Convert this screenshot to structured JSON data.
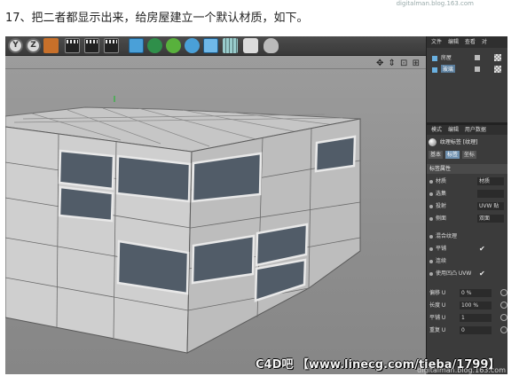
{
  "caption": "17、把二者都显示出来，给房屋建立一个默认材质，如下。",
  "top_watermark": "digitalman.blog.163.com",
  "toolbar": {
    "icons": [
      "y-axis-icon",
      "z-axis-icon",
      "world-coord-icon",
      "render-view-icon",
      "render-active-icon",
      "render-settings-icon",
      "cube-primitive-icon",
      "pen-spline-icon",
      "subdivision-gear-icon",
      "geometry-generator-icon",
      "deformer-grid-icon",
      "camera-icon",
      "light-bulb-icon"
    ],
    "y_label": "Y",
    "z_label": "Z"
  },
  "viewport": {
    "nav_icons": "✥ ⇕ ⊡ ⊞"
  },
  "object_manager": {
    "tabs": [
      "文件",
      "编辑",
      "查看",
      "对"
    ],
    "objects": [
      {
        "name": "房屋",
        "selected": false
      },
      {
        "name": "玻璃",
        "selected": true
      }
    ]
  },
  "attribute_manager": {
    "tabs": [
      "模式",
      "编辑",
      "用户数据"
    ],
    "header": "纹理标签 [纹理]",
    "subtabs": [
      {
        "label": "基本",
        "active": false
      },
      {
        "label": "标签",
        "active": true
      },
      {
        "label": "坐标",
        "active": false
      }
    ],
    "section": "标签属性",
    "props": [
      {
        "label": "材质",
        "value": "材质"
      },
      {
        "label": "选集",
        "value": ""
      },
      {
        "label": "投射",
        "value": "UVW 贴"
      },
      {
        "label": "侧面",
        "value": "双面"
      }
    ],
    "checks": [
      {
        "label": "混合纹理",
        "value": ""
      },
      {
        "label": "平铺",
        "value": "✔"
      },
      {
        "label": "连续",
        "value": ""
      },
      {
        "label": "使用凹凸 UVW",
        "value": "✔"
      }
    ],
    "numbers": [
      {
        "label": "偏移 U",
        "value": "0 %"
      },
      {
        "label": "长度 U",
        "value": "100 %"
      },
      {
        "label": "平铺 U",
        "value": "1"
      },
      {
        "label": "重复 U",
        "value": "0"
      }
    ]
  },
  "watermark": {
    "main": "C4D吧 【www.linecg.com/tieba/1799】",
    "small": "digitalman.blog.163.com"
  },
  "colors": {
    "building_face": "#d4d4d4",
    "window_glass": "#4f5a66",
    "panel_bg": "#3b3b3b"
  }
}
